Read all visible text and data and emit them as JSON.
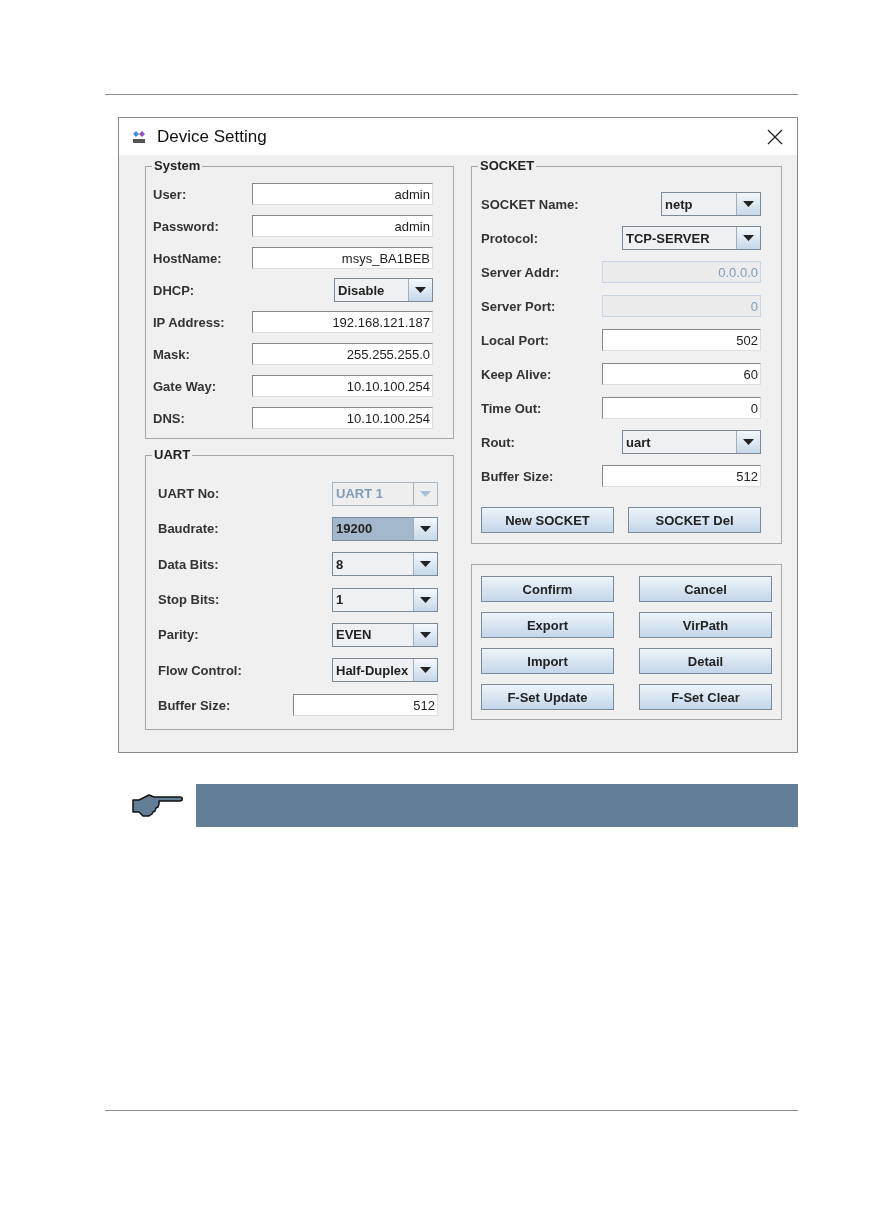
{
  "window": {
    "title": "Device Setting"
  },
  "left_groups": [
    {
      "title": "System",
      "rows": [
        {
          "kind": "text",
          "label": "User:",
          "value": "admin",
          "disabled": false
        },
        {
          "kind": "text",
          "label": "Password:",
          "value": "admin",
          "disabled": false
        },
        {
          "kind": "text",
          "label": "HostName:",
          "value": "msys_BA1BEB",
          "disabled": false
        },
        {
          "kind": "combo",
          "label": "DHCP:",
          "value": "Disable",
          "disabled": false,
          "highlighted": false
        },
        {
          "kind": "text",
          "label": "IP Address:",
          "value": "192.168.121.187",
          "disabled": false
        },
        {
          "kind": "text",
          "label": "Mask:",
          "value": "255.255.255.0",
          "disabled": false
        },
        {
          "kind": "text",
          "label": "Gate Way:",
          "value": "10.10.100.254",
          "disabled": false
        },
        {
          "kind": "text",
          "label": "DNS:",
          "value": "10.10.100.254",
          "disabled": false
        }
      ]
    },
    {
      "title": "UART",
      "rows": [
        {
          "kind": "combo",
          "label": "UART No:",
          "value": "UART 1",
          "disabled": true,
          "highlighted": false
        },
        {
          "kind": "combo",
          "label": "Baudrate:",
          "value": "19200",
          "disabled": false,
          "highlighted": true
        },
        {
          "kind": "combo",
          "label": "Data Bits:",
          "value": "8",
          "disabled": false,
          "highlighted": false
        },
        {
          "kind": "combo",
          "label": "Stop Bits:",
          "value": "1",
          "disabled": false,
          "highlighted": false
        },
        {
          "kind": "combo",
          "label": "Parity:",
          "value": "EVEN",
          "disabled": false,
          "highlighted": false
        },
        {
          "kind": "combo",
          "label": "Flow Control:",
          "value": "Half-Duplex",
          "disabled": false,
          "highlighted": false
        },
        {
          "kind": "text",
          "label": "Buffer Size:",
          "value": "512",
          "disabled": false
        }
      ]
    }
  ],
  "socket": {
    "title": "SOCKET",
    "rows": [
      {
        "kind": "combo",
        "label": "SOCKET Name:",
        "value": "netp",
        "disabled": false,
        "highlighted": false
      },
      {
        "kind": "combo",
        "label": "Protocol:",
        "value": "TCP-SERVER",
        "disabled": false,
        "highlighted": false
      },
      {
        "kind": "text",
        "label": "Server Addr:",
        "value": "0.0.0.0",
        "disabled": true
      },
      {
        "kind": "text",
        "label": "Server Port:",
        "value": "0",
        "disabled": true
      },
      {
        "kind": "text",
        "label": "Local Port:",
        "value": "502",
        "disabled": false
      },
      {
        "kind": "text",
        "label": "Keep Alive:",
        "value": "60",
        "disabled": false
      },
      {
        "kind": "text",
        "label": "Time Out:",
        "value": "0",
        "disabled": false
      },
      {
        "kind": "combo",
        "label": "Rout:",
        "value": "uart",
        "disabled": false,
        "highlighted": false
      },
      {
        "kind": "text",
        "label": "Buffer Size:",
        "value": "512",
        "disabled": false
      }
    ],
    "buttons": [
      "New SOCKET",
      "SOCKET Del"
    ]
  },
  "actions": [
    "Confirm",
    "Cancel",
    "Export",
    "VirPath",
    "Import",
    "Detail",
    "F-Set Update",
    "F-Set Clear"
  ]
}
